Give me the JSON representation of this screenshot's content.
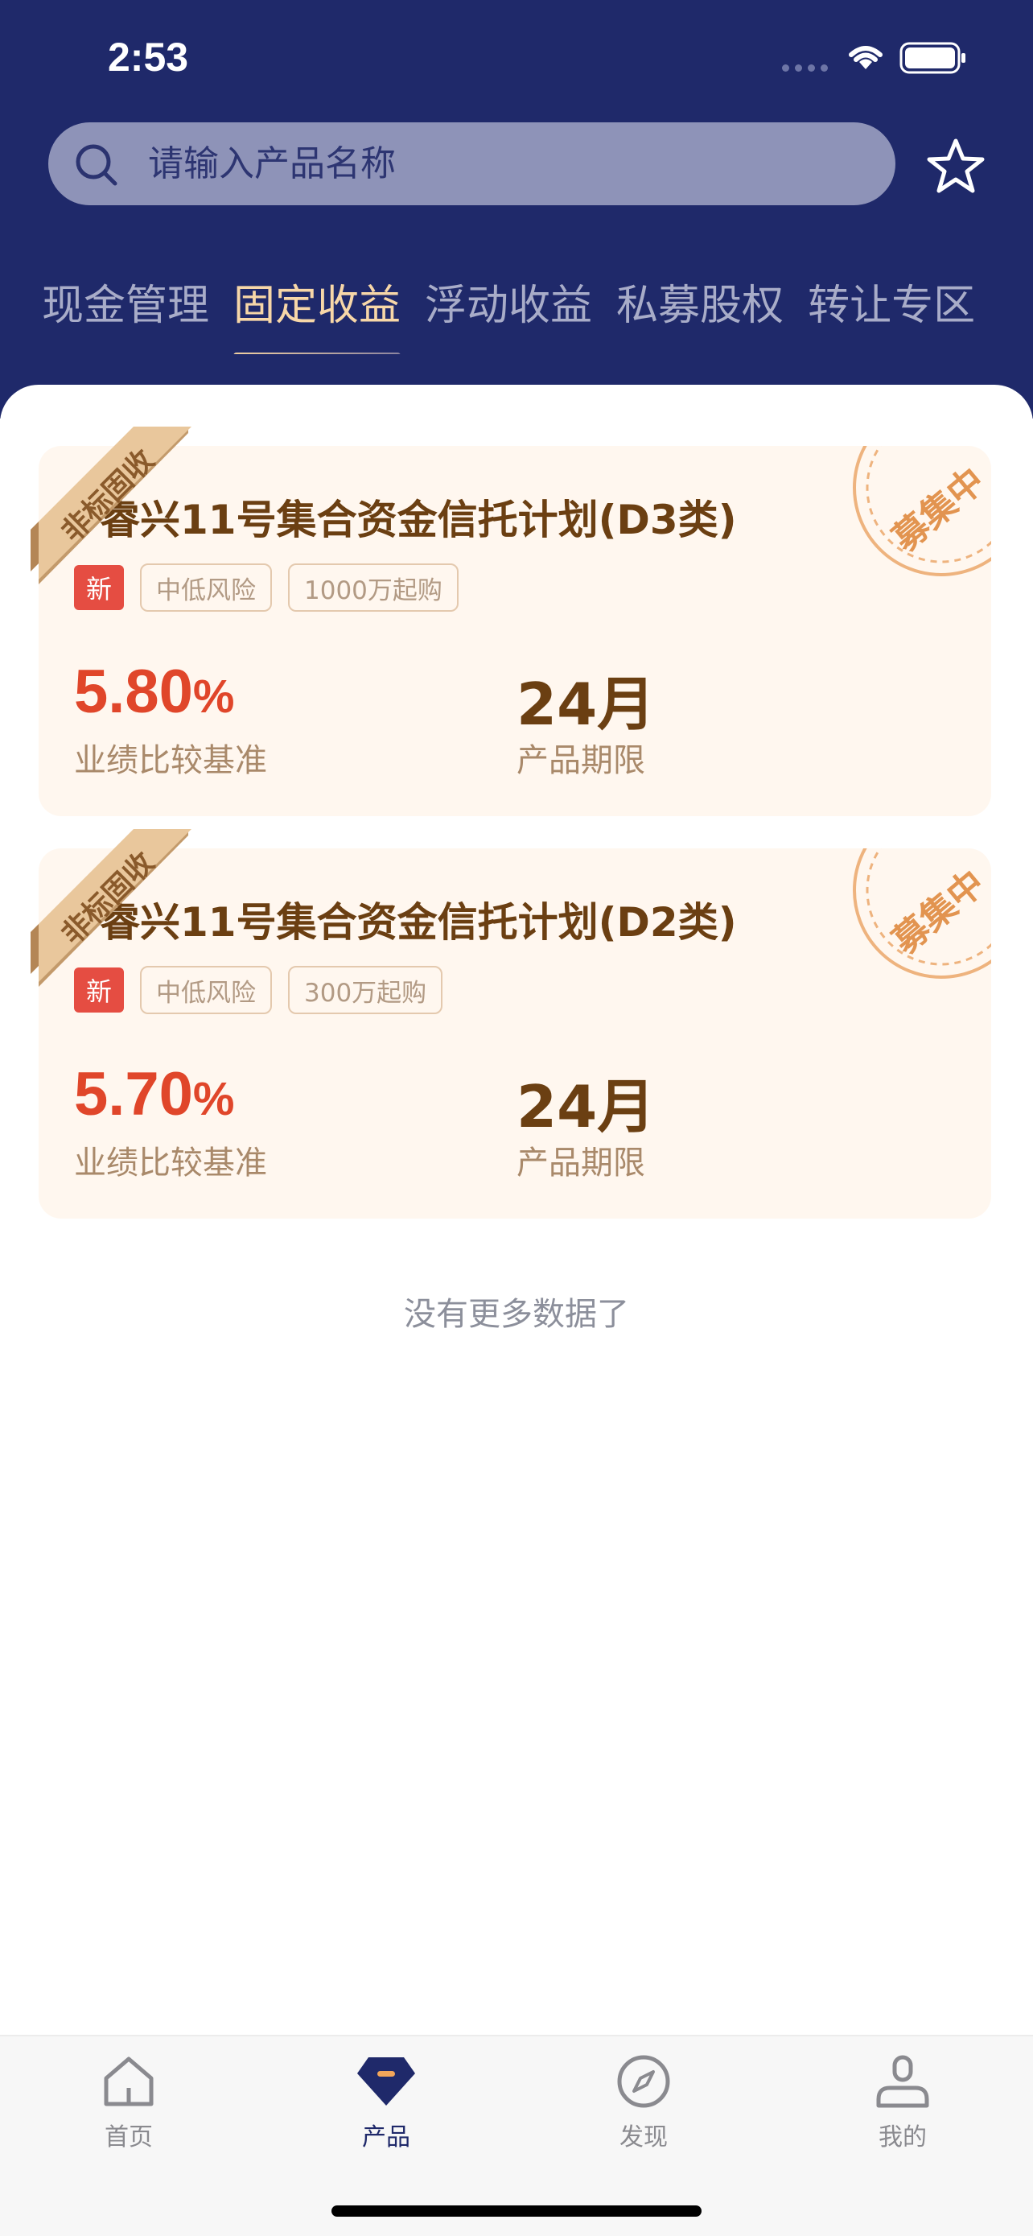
{
  "status_bar": {
    "time": "2:53"
  },
  "search": {
    "placeholder": "请输入产品名称"
  },
  "tabs": [
    {
      "label": "现金管理",
      "active": false
    },
    {
      "label": "固定收益",
      "active": true
    },
    {
      "label": "浮动收益",
      "active": false
    },
    {
      "label": "私募股权",
      "active": false
    },
    {
      "label": "转让专区",
      "active": false
    }
  ],
  "products": [
    {
      "ribbon": "非标固收",
      "status": "募集中",
      "title": "睿兴11号集合资金信托计划(D3类)",
      "tag_new": "新",
      "tags": [
        "中低风险",
        "1000万起购"
      ],
      "rate": "5.80",
      "rate_unit": "%",
      "rate_label": "业绩比较基准",
      "term": "24月",
      "term_label": "产品期限"
    },
    {
      "ribbon": "非标固收",
      "status": "募集中",
      "title": "睿兴11号集合资金信托计划(D2类)",
      "tag_new": "新",
      "tags": [
        "中低风险",
        "300万起购"
      ],
      "rate": "5.70",
      "rate_unit": "%",
      "rate_label": "业绩比较基准",
      "term": "24月",
      "term_label": "产品期限"
    }
  ],
  "no_more": "没有更多数据了",
  "tabbar": [
    {
      "label": "首页",
      "icon": "home-icon",
      "active": false
    },
    {
      "label": "产品",
      "icon": "product-gem-icon",
      "active": true
    },
    {
      "label": "发现",
      "icon": "compass-icon",
      "active": false
    },
    {
      "label": "我的",
      "icon": "person-icon",
      "active": false
    }
  ],
  "colors": {
    "header_bg": "#1f296a",
    "accent_red": "#e0462a",
    "gold_text": "#6b3f12",
    "card_bg": "#fff7ef"
  }
}
